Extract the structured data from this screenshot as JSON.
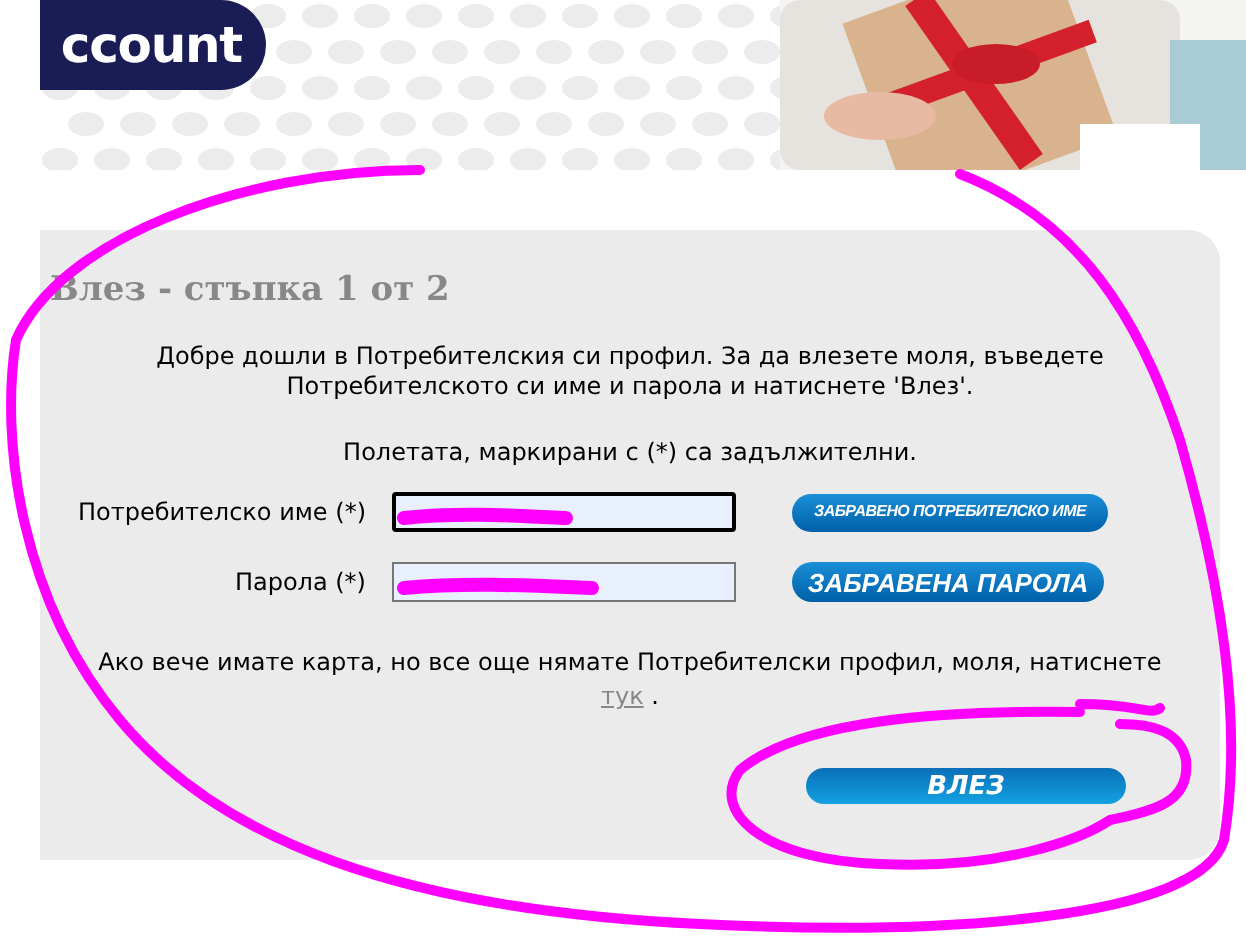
{
  "header": {
    "logo": "ccount"
  },
  "login": {
    "title": "Влез - стъпка 1 от 2",
    "intro": "Добре дошли в Потребителския си профил. За да влезете моля, въведете Потребителското си име и парола и натиснете 'Влез'.",
    "required_note": "Полетата, маркирани с (*) са задължителни.",
    "fields": [
      {
        "label": "Потребителско име (*)",
        "focused": true,
        "button": "ЗАБРАВЕНО ПОТРЕБИТЕЛСКО ИМЕ",
        "kind": "small"
      },
      {
        "label": "Парола (*)",
        "focused": false,
        "button": "ЗАБРАВЕНА ПАРОЛА",
        "kind": "large"
      }
    ],
    "register_text": "Ако вече имате карта, но все още нямате Потребителски профил, моля, натиснете",
    "register_link": "тук",
    "register_end": ".",
    "submit": "ВЛЕЗ"
  }
}
